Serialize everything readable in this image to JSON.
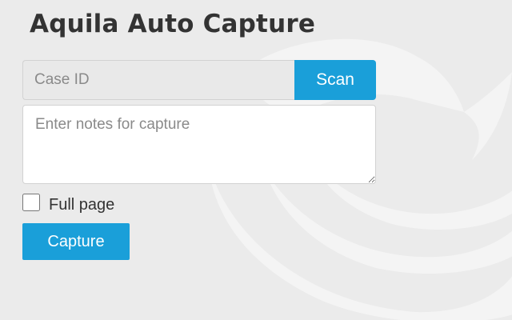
{
  "app": {
    "title": "Aquila Auto Capture"
  },
  "case_id": {
    "value": "",
    "placeholder": "Case ID"
  },
  "scan_button": {
    "label": "Scan"
  },
  "notes": {
    "value": "",
    "placeholder": "Enter notes for capture"
  },
  "full_page": {
    "label": "Full page",
    "checked": false
  },
  "capture_button": {
    "label": "Capture"
  },
  "colors": {
    "background": "#ebebeb",
    "accent": "#1a9fd9",
    "title": "#333333",
    "watermark": "#f4f4f4"
  },
  "icons": {
    "background_logo": "aquila-eagle-logo"
  }
}
